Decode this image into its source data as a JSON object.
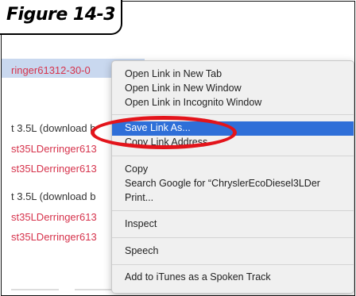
{
  "figure_label": "Figure 14-3",
  "left_column": [
    {
      "text": "ringer61312-30-0",
      "style": "red"
    },
    {
      "text": "t 3.5L (download b",
      "style": "gray"
    },
    {
      "text": "st35LDerringer613",
      "style": "red"
    },
    {
      "text": "st35LDerringer613",
      "style": "red"
    },
    {
      "text": "t 3.5L (download b",
      "style": "gray"
    },
    {
      "text": "st35LDerringer613",
      "style": "red"
    },
    {
      "text": "st35LDerringer613",
      "style": "red"
    }
  ],
  "context_menu": {
    "items": [
      "Open Link in New Tab",
      "Open Link in New Window",
      "Open Link in Incognito Window",
      "Save Link As...",
      "Copy Link Address",
      "Copy",
      "Search Google for “ChryslerEcoDiesel3LDer",
      "Print...",
      "Inspect",
      "Speech",
      "Add to iTunes as a Spoken Track"
    ],
    "selected": "Save Link As...",
    "selection_color": "#2f6fd8"
  },
  "annotation": {
    "shape": "oval",
    "color": "#e3141b"
  }
}
